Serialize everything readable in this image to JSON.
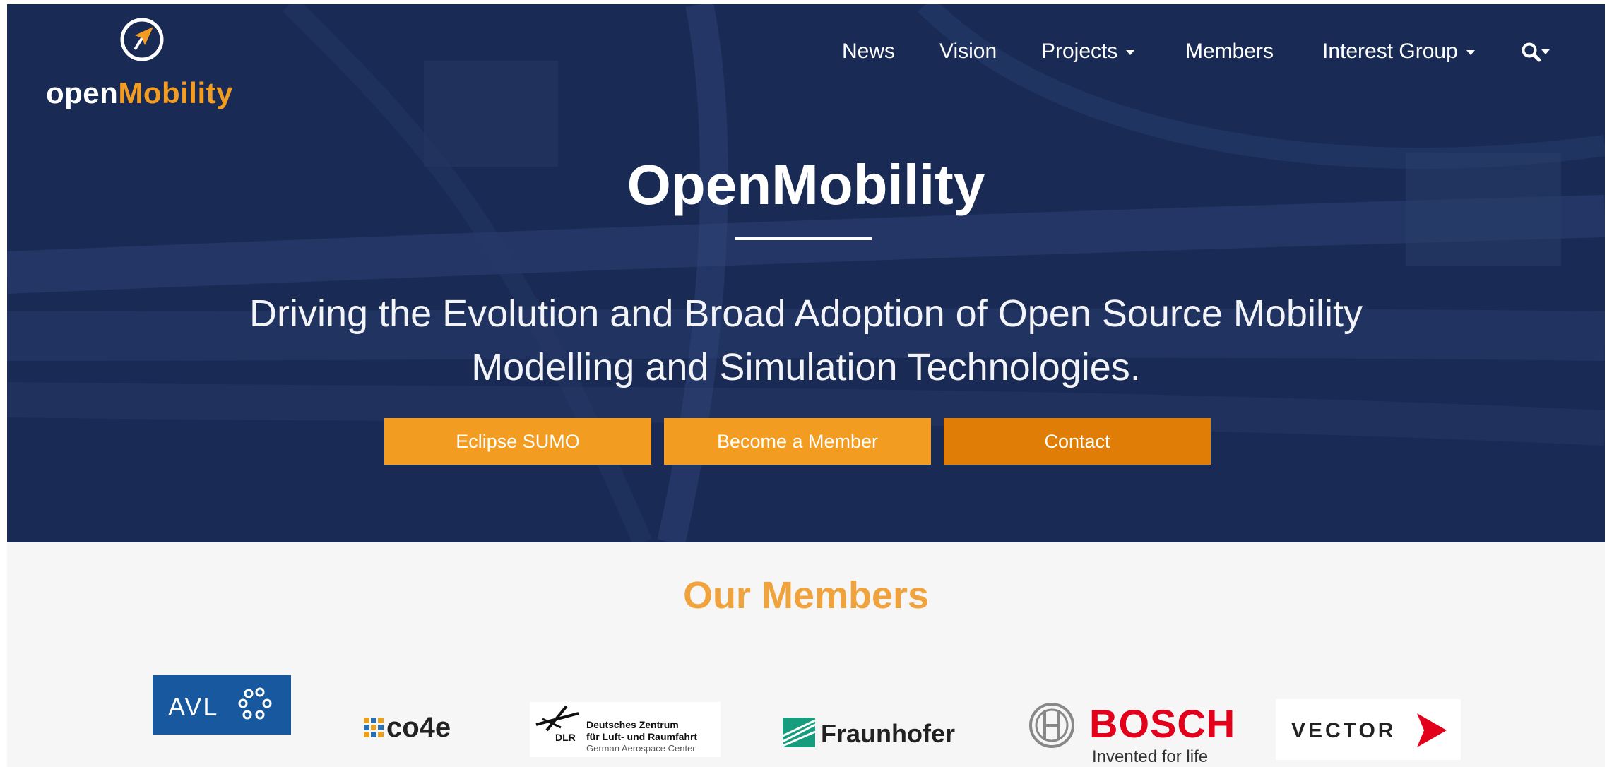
{
  "brand": {
    "logo_part1": "open",
    "logo_part2": "Mobility",
    "colors": {
      "navy": "#1b2c59",
      "orange": "#f39c22",
      "orange_dark": "#e07d06",
      "heading_orange": "#f0a23d"
    }
  },
  "nav": {
    "items": [
      {
        "label": "News",
        "dropdown": false
      },
      {
        "label": "Vision",
        "dropdown": false
      },
      {
        "label": "Projects",
        "dropdown": true
      },
      {
        "label": "Members",
        "dropdown": false
      },
      {
        "label": "Interest Group",
        "dropdown": true
      }
    ],
    "search_icon": "search-icon"
  },
  "hero": {
    "title": "OpenMobility",
    "subtitle_line1": "Driving the Evolution and Broad Adoption of Open Source Mobility",
    "subtitle_line2": "Modelling and Simulation Technologies.",
    "buttons": [
      "Eclipse SUMO",
      "Become a Member",
      "Contact"
    ]
  },
  "members": {
    "heading": "Our Members",
    "logos": [
      {
        "name": "AVL",
        "text": "AVL"
      },
      {
        "name": "co4e",
        "text": "co4e"
      },
      {
        "name": "DLR",
        "code": "DLR",
        "line1": "Deutsches Zentrum",
        "line2": "für Luft- und Raumfahrt",
        "line3": "German Aerospace Center"
      },
      {
        "name": "Fraunhofer",
        "text": "Fraunhofer"
      },
      {
        "name": "Bosch",
        "text": "BOSCH",
        "tagline": "Invented for life"
      },
      {
        "name": "Vector",
        "text": "VECTOR"
      }
    ]
  }
}
